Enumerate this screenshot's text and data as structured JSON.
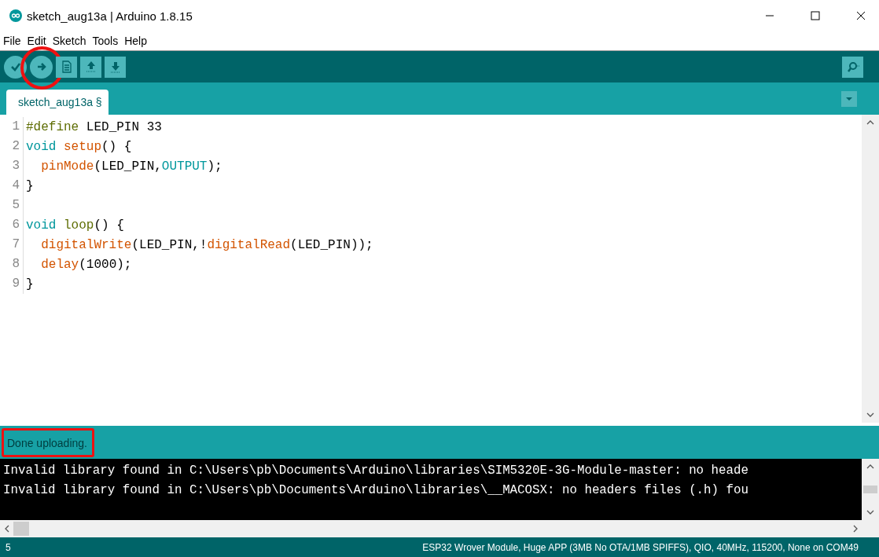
{
  "window": {
    "title": "sketch_aug13a | Arduino 1.8.15"
  },
  "menu": [
    "File",
    "Edit",
    "Sketch",
    "Tools",
    "Help"
  ],
  "toolbar": [
    {
      "kind": "verify",
      "highlighted": false
    },
    {
      "kind": "upload",
      "highlighted": true
    },
    {
      "kind": "new",
      "highlighted": false
    },
    {
      "kind": "open",
      "highlighted": false
    },
    {
      "kind": "save",
      "highlighted": false
    }
  ],
  "tabs": [
    {
      "label": "sketch_aug13a §",
      "selected": true
    }
  ],
  "code": [
    {
      "number": "1",
      "tokens": [
        {
          "kind": "preproc",
          "text": "#define"
        },
        {
          "kind": "plain",
          "text": " LED_PIN 33"
        }
      ]
    },
    {
      "number": "2",
      "tokens": [
        {
          "kind": "keyword",
          "text": "void"
        },
        {
          "kind": "function",
          "text": " setup"
        },
        {
          "kind": "plain",
          "text": "() {"
        }
      ]
    },
    {
      "number": "3",
      "tokens": [
        {
          "kind": "function",
          "text": "  pinMode"
        },
        {
          "kind": "plain",
          "text": "(LED_PIN,"
        },
        {
          "kind": "keyword",
          "text": "OUTPUT"
        },
        {
          "kind": "plain",
          "text": ");"
        }
      ]
    },
    {
      "number": "4",
      "tokens": [
        {
          "kind": "plain",
          "text": "}"
        }
      ]
    },
    {
      "number": "5"
    },
    {
      "number": "6",
      "tokens": [
        {
          "kind": "keyword",
          "text": "void"
        },
        {
          "kind": "preproc",
          "text": " loop"
        },
        {
          "kind": "plain",
          "text": "() {"
        }
      ]
    },
    {
      "number": "7",
      "tokens": [
        {
          "kind": "function",
          "text": "  digitalWrite"
        },
        {
          "kind": "plain",
          "text": "(LED_PIN,!"
        },
        {
          "kind": "function",
          "text": "digitalRead"
        },
        {
          "kind": "plain",
          "text": "(LED_PIN));"
        }
      ]
    },
    {
      "number": "8",
      "tokens": [
        {
          "kind": "function",
          "text": "  delay"
        },
        {
          "kind": "plain",
          "text": "(1000);"
        }
      ]
    },
    {
      "number": "9",
      "tokens": [
        {
          "kind": "plain",
          "text": "}"
        }
      ]
    }
  ],
  "message": {
    "text": "Done uploading.",
    "highlighted": true
  },
  "console": [
    "Invalid library found in C:\\Users\\pb\\Documents\\Arduino\\libraries\\SIM5320E-3G-Module-master: no heade",
    "Invalid library found in C:\\Users\\pb\\Documents\\Arduino\\libraries\\__MACOSX: no headers files (.h) fou"
  ],
  "status_bar": {
    "line": "5",
    "board": "ESP32 Wrover Module, Huge APP (3MB No OTA/1MB SPIFFS), QIO, 40MHz, 115200, None on COM49"
  }
}
